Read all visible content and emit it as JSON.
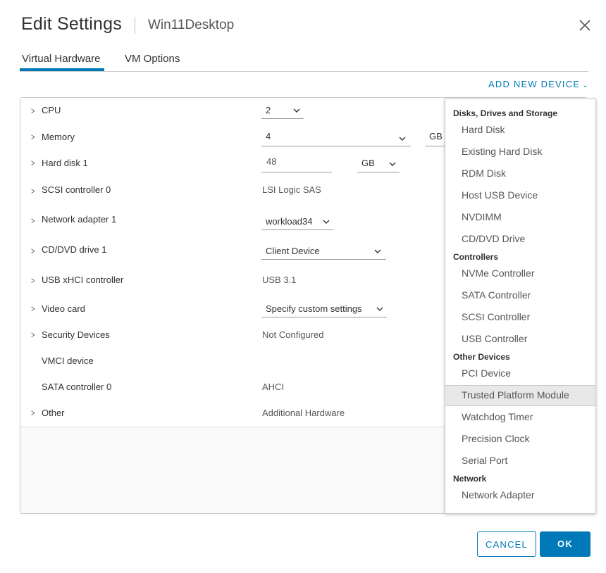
{
  "header": {
    "title": "Edit Settings",
    "subtitle": "Win11Desktop"
  },
  "tabs": [
    {
      "label": "Virtual Hardware",
      "selected": true
    },
    {
      "label": "VM Options",
      "selected": false
    }
  ],
  "add_device": {
    "label": "ADD NEW DEVICE"
  },
  "hardware": {
    "cpu": {
      "label": "CPU",
      "value": "2"
    },
    "memory": {
      "label": "Memory",
      "value": "4",
      "unit": "GB"
    },
    "hard_disk": {
      "label": "Hard disk 1",
      "value": "48",
      "unit": "GB"
    },
    "scsi": {
      "label": "SCSI controller 0",
      "value": "LSI Logic SAS"
    },
    "network": {
      "label": "Network adapter 1",
      "value": "workload34"
    },
    "cddvd": {
      "label": "CD/DVD drive 1",
      "value": "Client Device"
    },
    "usb": {
      "label": "USB xHCI controller",
      "value": "USB 3.1"
    },
    "video": {
      "label": "Video card",
      "value": "Specify custom settings"
    },
    "security": {
      "label": "Security Devices",
      "value": "Not Configured"
    },
    "vmci": {
      "label": "VMCI device",
      "value": ""
    },
    "sata": {
      "label": "SATA controller 0",
      "value": "AHCI"
    },
    "other": {
      "label": "Other",
      "value": "Additional Hardware"
    }
  },
  "menu": {
    "disks_header": "Disks, Drives and Storage",
    "disks": [
      "Hard Disk",
      "Existing Hard Disk",
      "RDM Disk",
      "Host USB Device",
      "NVDIMM",
      "CD/DVD Drive"
    ],
    "controllers_header": "Controllers",
    "controllers": [
      "NVMe Controller",
      "SATA Controller",
      "SCSI Controller",
      "USB Controller"
    ],
    "other_header": "Other Devices",
    "other": [
      "PCI Device",
      "Trusted Platform Module",
      "Watchdog Timer",
      "Precision Clock",
      "Serial Port"
    ],
    "network_header": "Network",
    "network": [
      "Network Adapter"
    ],
    "highlighted_item": "Trusted Platform Module"
  },
  "footer": {
    "cancel_label": "CANCEL",
    "ok_label": "OK"
  },
  "colors": {
    "accent": "#0079b8",
    "text": "#313131",
    "muted": "#565656",
    "border": "#cccccc"
  },
  "icons": {
    "close": "close-icon",
    "expand": "chevron-right-icon",
    "dropdown": "chevron-down-icon"
  }
}
